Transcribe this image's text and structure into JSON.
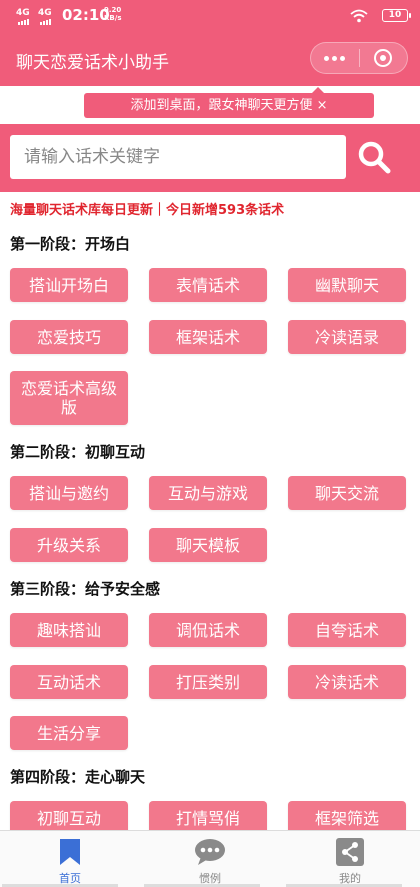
{
  "status_bar": {
    "network_1": "4G",
    "network_2": "4G",
    "time": "02:10",
    "net_speed_value": "9.20",
    "net_speed_unit": "KB/s",
    "battery": "10"
  },
  "navbar": {
    "title": "聊天恋爱话术小助手",
    "icons": [
      "more-dots-icon",
      "close-ring-icon"
    ]
  },
  "tip": {
    "text": "添加到桌面，跟女神聊天更方便 ×"
  },
  "search": {
    "placeholder": "请输入话术关键字",
    "value": "",
    "button_icon": "search-icon"
  },
  "notice": "海量聊天话术库每日更新｜今日新增593条话术",
  "sections": [
    {
      "title": "第一阶段：开场白",
      "tags": [
        "搭讪开场白",
        "表情话术",
        "幽默聊天",
        "恋爱技巧",
        "框架话术",
        "冷读语录",
        "恋爱话术高级版"
      ]
    },
    {
      "title": "第二阶段：初聊互动",
      "tags": [
        "搭讪与邀约",
        "互动与游戏",
        "聊天交流",
        "升级关系",
        "聊天模板"
      ]
    },
    {
      "title": "第三阶段：给予安全感",
      "tags": [
        "趣味搭讪",
        "调侃话术",
        "自夸话术",
        "互动话术",
        "打压类别",
        "冷读话术",
        "生活分享"
      ]
    },
    {
      "title": "第四阶段：走心聊天",
      "tags": [
        "初聊互动",
        "打情骂俏",
        "框架筛选"
      ]
    }
  ],
  "tabbar": {
    "items": [
      {
        "label": "首页",
        "icon": "bookmark-icon",
        "active": true
      },
      {
        "label": "惯例",
        "icon": "chat-bubble-icon",
        "active": false
      },
      {
        "label": "我的",
        "icon": "share-icon",
        "active": false
      }
    ]
  },
  "colors": {
    "brand": "#f05c7a",
    "tag_bg": "#f2788c",
    "notice": "#e0262f",
    "tab_active": "#3b6fd6"
  }
}
